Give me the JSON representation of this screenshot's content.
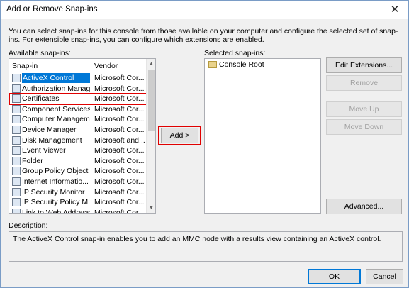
{
  "window": {
    "title": "Add or Remove Snap-ins",
    "close_glyph": "✕"
  },
  "intro": "You can select snap-ins for this console from those available on your computer and configure the selected set of snap-ins. For extensible snap-ins, you can configure which extensions are enabled.",
  "available": {
    "label": "Available snap-ins:",
    "columns": {
      "snapin": "Snap-in",
      "vendor": "Vendor"
    },
    "items": [
      {
        "name": "ActiveX Control",
        "vendor": "Microsoft Cor...",
        "icon": "activex-icon"
      },
      {
        "name": "Authorization Manager",
        "vendor": "Microsoft Cor...",
        "icon": "authorization-icon"
      },
      {
        "name": "Certificates",
        "vendor": "Microsoft Cor...",
        "icon": "certificate-icon"
      },
      {
        "name": "Component Services",
        "vendor": "Microsoft Cor...",
        "icon": "component-services-icon"
      },
      {
        "name": "Computer Managem...",
        "vendor": "Microsoft Cor...",
        "icon": "computer-management-icon"
      },
      {
        "name": "Device Manager",
        "vendor": "Microsoft Cor...",
        "icon": "device-manager-icon"
      },
      {
        "name": "Disk Management",
        "vendor": "Microsoft and...",
        "icon": "disk-management-icon"
      },
      {
        "name": "Event Viewer",
        "vendor": "Microsoft Cor...",
        "icon": "event-viewer-icon"
      },
      {
        "name": "Folder",
        "vendor": "Microsoft Cor...",
        "icon": "folder-icon"
      },
      {
        "name": "Group Policy Object ...",
        "vendor": "Microsoft Cor...",
        "icon": "group-policy-icon"
      },
      {
        "name": "Internet Informatio...",
        "vendor": "Microsoft Cor...",
        "icon": "iis-icon"
      },
      {
        "name": "IP Security Monitor",
        "vendor": "Microsoft Cor...",
        "icon": "ip-security-monitor-icon"
      },
      {
        "name": "IP Security Policy M...",
        "vendor": "Microsoft Cor...",
        "icon": "ip-security-policy-icon"
      },
      {
        "name": "Link to Web Address",
        "vendor": "Microsoft Cor...",
        "icon": "link-icon"
      }
    ],
    "selected_item": "ActiveX Control",
    "highlighted_item": "Certificates"
  },
  "add_button": "Add >",
  "selected": {
    "label": "Selected snap-ins:",
    "items": [
      {
        "name": "Console Root",
        "icon": "console-root-folder-icon"
      }
    ]
  },
  "buttons": {
    "edit_extensions": "Edit Extensions...",
    "remove": "Remove",
    "move_up": "Move Up",
    "move_down": "Move Down",
    "advanced": "Advanced...",
    "ok": "OK",
    "cancel": "Cancel"
  },
  "description": {
    "label": "Description:",
    "text": "The ActiveX Control snap-in enables you to add an MMC node with a results view containing an ActiveX control."
  },
  "colors": {
    "selection": "#0078d7",
    "highlight_box": "#e00000",
    "dialog_bg": "#f0f0f0"
  }
}
